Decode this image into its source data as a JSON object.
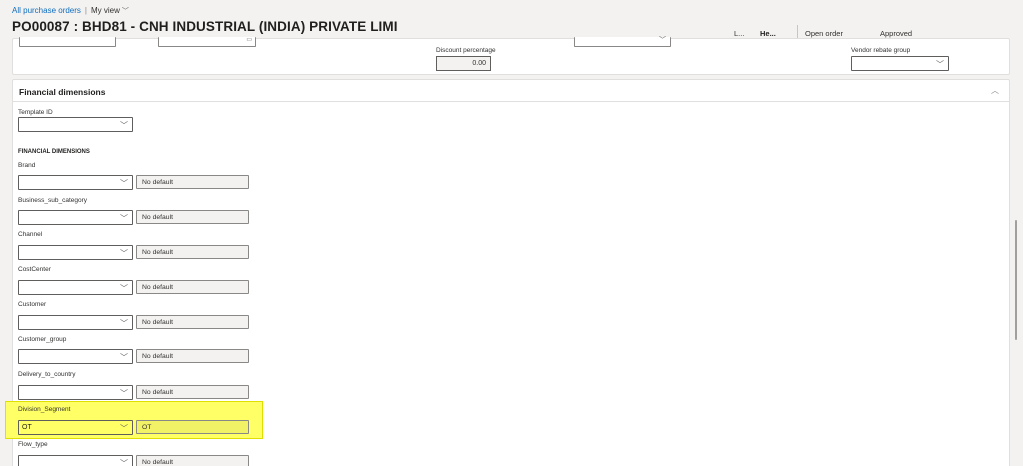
{
  "breadcrumb": {
    "link": "All purchase orders",
    "separator": "|",
    "view": "My view"
  },
  "page_title": "PO00087 : BHD81 - CNH INDUSTRIAL (INDIA) PRIVATE LIMI",
  "header": {
    "more": "L...",
    "tab_active": "He...",
    "status_order": "Open order",
    "status_approval": "Approved"
  },
  "top_section": {
    "discount_percentage_label": "Discount percentage",
    "discount_percentage_value": "0.00",
    "vendor_rebate_group_label": "Vendor rebate group"
  },
  "financial_dimensions": {
    "title": "Financial dimensions",
    "template_id_label": "Template ID",
    "subheading": "FINANCIAL DIMENSIONS",
    "rows": [
      {
        "label": "Brand",
        "value": "",
        "default": "No default"
      },
      {
        "label": "Business_sub_category",
        "value": "",
        "default": "No default"
      },
      {
        "label": "Channel",
        "value": "",
        "default": "No default"
      },
      {
        "label": "CostCenter",
        "value": "",
        "default": "No default"
      },
      {
        "label": "Customer",
        "value": "",
        "default": "No default"
      },
      {
        "label": "Customer_group",
        "value": "",
        "default": "No default"
      },
      {
        "label": "Delivery_to_country",
        "value": "",
        "default": "No default"
      },
      {
        "label": "Division_Segment",
        "value": "OT",
        "default": "OT"
      },
      {
        "label": "Flow_type",
        "value": "",
        "default": "No default"
      }
    ]
  },
  "colors": {
    "accent": "#0f6cbd",
    "highlight": "#ffff66"
  }
}
